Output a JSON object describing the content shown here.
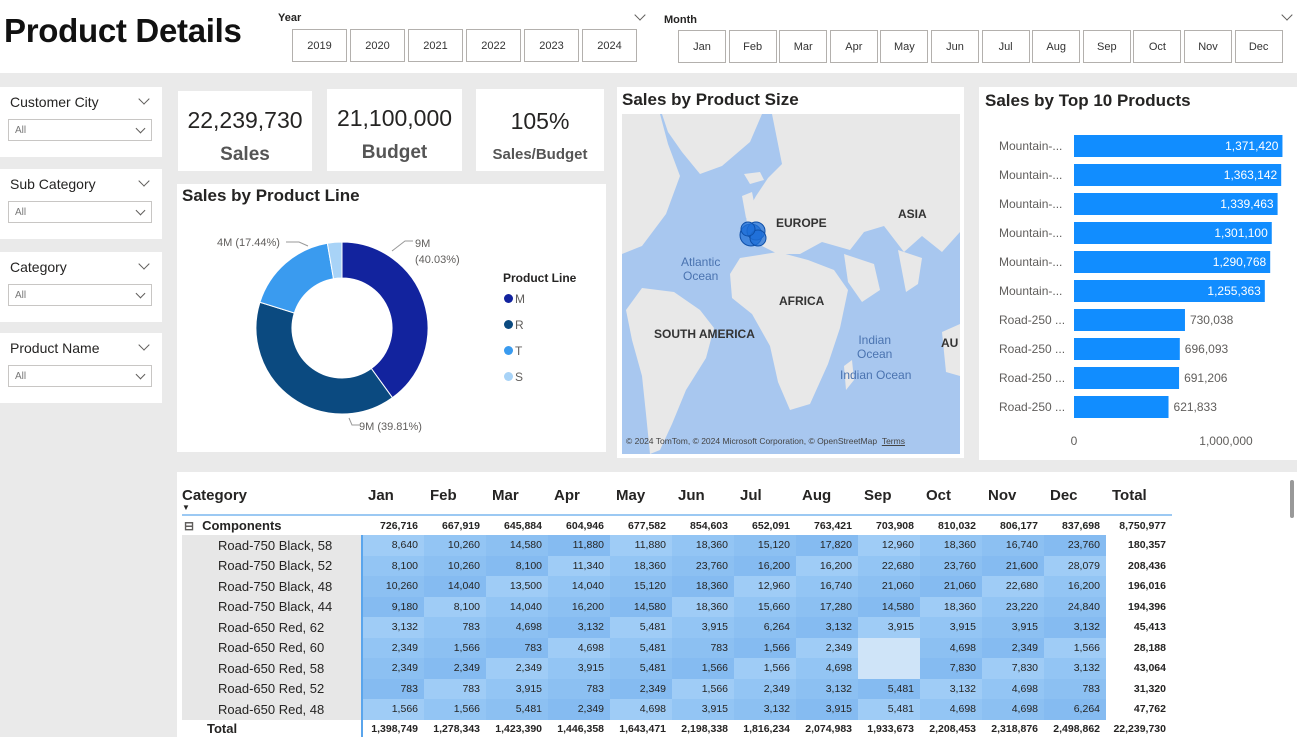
{
  "page": {
    "title": "Product Details"
  },
  "year_slicer": {
    "title": "Year",
    "options": [
      "2019",
      "2020",
      "2021",
      "2022",
      "2023",
      "2024"
    ]
  },
  "month_slicer": {
    "title": "Month",
    "options": [
      "Jan",
      "Feb",
      "Mar",
      "Apr",
      "May",
      "Jun",
      "Jul",
      "Aug",
      "Sep",
      "Oct",
      "Nov",
      "Dec"
    ]
  },
  "filters": [
    {
      "label": "Customer City",
      "value": "All"
    },
    {
      "label": "Sub Category",
      "value": "All"
    },
    {
      "label": "Category",
      "value": "All"
    },
    {
      "label": "Product Name",
      "value": "All"
    }
  ],
  "kpis": [
    {
      "value": "22,239,730",
      "label": "Sales"
    },
    {
      "value": "21,100,000",
      "label": "Budget"
    },
    {
      "value": "105%",
      "label": "Sales/Budget"
    }
  ],
  "donut": {
    "title": "Sales by Product Line",
    "legend_title": "Product Line",
    "labels": {
      "m_value": "9M",
      "m_pct": "(40.03%)",
      "r": "9M (39.81%)",
      "t": "4M (17.44%)"
    },
    "colors": {
      "M": "#12239e",
      "R": "#0b4a80",
      "T": "#3a9bef",
      "S": "#a8d3f7"
    }
  },
  "map": {
    "title": "Sales by Product Size",
    "labels": {
      "europe": "EUROPE",
      "asia": "ASIA",
      "africa": "AFRICA",
      "south_america": "SOUTH AMERICA",
      "atlantic_1": "Atlantic",
      "atlantic_2": "Ocean",
      "indian_1": "Indian",
      "indian_2": "Ocean",
      "indian_full": "Indian Ocean",
      "au": "AU"
    },
    "attribution": "© 2024 TomTom, © 2024 Microsoft Corporation, © OpenStreetMap",
    "terms": "Terms"
  },
  "chart_data": {
    "type": "bar",
    "orientation": "horizontal",
    "title": "Sales by Top 10 Products",
    "categories": [
      "Mountain-...",
      "Mountain-...",
      "Mountain-...",
      "Mountain-...",
      "Mountain-...",
      "Mountain-...",
      "Road-250 ...",
      "Road-250 ...",
      "Road-250 ...",
      "Road-250 ..."
    ],
    "values": [
      1371420,
      1363142,
      1339463,
      1301100,
      1290768,
      1255363,
      730038,
      696093,
      691206,
      621833
    ],
    "data_labels": [
      "1,371,420",
      "1,363,142",
      "1,339,463",
      "1,301,100",
      "1,290,768",
      "1,255,363",
      "730,038",
      "696,093",
      "691,206",
      "621,833"
    ],
    "xlim": [
      0,
      1500000
    ],
    "x_ticks": [
      {
        "value": 0,
        "label": "0"
      },
      {
        "value": 1000000,
        "label": "1,000,000"
      }
    ],
    "color": "#118dff"
  },
  "matrix": {
    "corner": "Category",
    "columns": [
      "Jan",
      "Feb",
      "Mar",
      "Apr",
      "May",
      "Jun",
      "Jul",
      "Aug",
      "Sep",
      "Oct",
      "Nov",
      "Dec",
      "Total"
    ],
    "group": {
      "expand_symbol": "⊟",
      "label": "Components",
      "values": [
        "726,716",
        "667,919",
        "645,884",
        "604,946",
        "677,582",
        "854,603",
        "652,091",
        "763,421",
        "703,908",
        "810,032",
        "806,177",
        "837,698",
        "8,750,977"
      ]
    },
    "rows": [
      {
        "label": "Road-750 Black, 58",
        "values": [
          "8,640",
          "10,260",
          "14,580",
          "11,880",
          "11,880",
          "18,360",
          "15,120",
          "17,820",
          "12,960",
          "18,360",
          "16,740",
          "23,760",
          "180,357"
        ]
      },
      {
        "label": "Road-750 Black, 52",
        "values": [
          "8,100",
          "10,260",
          "8,100",
          "11,340",
          "18,360",
          "23,760",
          "16,200",
          "16,200",
          "22,680",
          "23,760",
          "21,600",
          "28,079",
          "208,436"
        ]
      },
      {
        "label": "Road-750 Black, 48",
        "values": [
          "10,260",
          "14,040",
          "13,500",
          "14,040",
          "15,120",
          "18,360",
          "12,960",
          "16,740",
          "21,060",
          "21,060",
          "22,680",
          "16,200",
          "196,016"
        ]
      },
      {
        "label": "Road-750 Black, 44",
        "values": [
          "9,180",
          "8,100",
          "14,040",
          "16,200",
          "14,580",
          "18,360",
          "15,660",
          "17,280",
          "14,580",
          "18,360",
          "23,220",
          "24,840",
          "194,396"
        ]
      },
      {
        "label": "Road-650 Red, 62",
        "values": [
          "3,132",
          "783",
          "4,698",
          "3,132",
          "5,481",
          "3,915",
          "6,264",
          "3,132",
          "3,915",
          "3,915",
          "3,915",
          "3,132",
          "45,413"
        ]
      },
      {
        "label": "Road-650 Red, 60",
        "values": [
          "2,349",
          "1,566",
          "783",
          "4,698",
          "5,481",
          "783",
          "1,566",
          "2,349",
          "",
          "4,698",
          "2,349",
          "1,566",
          "28,188"
        ]
      },
      {
        "label": "Road-650 Red, 58",
        "values": [
          "2,349",
          "2,349",
          "2,349",
          "3,915",
          "5,481",
          "1,566",
          "1,566",
          "4,698",
          "",
          "7,830",
          "7,830",
          "3,132",
          "43,064"
        ]
      },
      {
        "label": "Road-650 Red, 52",
        "values": [
          "783",
          "783",
          "3,915",
          "783",
          "2,349",
          "1,566",
          "2,349",
          "3,132",
          "5,481",
          "3,132",
          "4,698",
          "783",
          "31,320"
        ]
      },
      {
        "label": "Road-650 Red, 48",
        "values": [
          "1,566",
          "1,566",
          "5,481",
          "2,349",
          "4,698",
          "3,915",
          "3,132",
          "3,915",
          "5,481",
          "4,698",
          "4,698",
          "6,264",
          "47,762"
        ]
      }
    ],
    "total": {
      "label": "Total",
      "values": [
        "1,398,749",
        "1,278,343",
        "1,423,390",
        "1,446,358",
        "1,643,471",
        "2,198,338",
        "1,816,234",
        "2,074,983",
        "1,933,673",
        "2,208,453",
        "2,318,876",
        "2,498,862",
        "22,239,730"
      ]
    }
  }
}
